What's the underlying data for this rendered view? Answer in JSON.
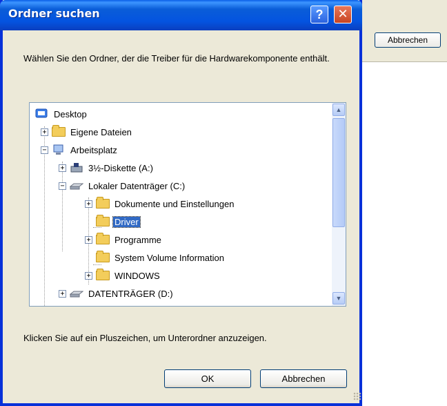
{
  "background": {
    "cancel_label": "Abbrechen"
  },
  "dialog": {
    "title": "Ordner suchen",
    "help_glyph": "?",
    "close_glyph": "✕",
    "instructions": "Wählen Sie den Ordner, der die Treiber für die Hardwarekomponente enthält.",
    "hint": "Klicken Sie auf ein Pluszeichen, um Unterordner anzuzeigen.",
    "ok_label": "OK",
    "cancel_label": "Abbrechen"
  },
  "tree": {
    "items": [
      {
        "label": "Desktop",
        "icon": "desktop-icon",
        "expander": "none",
        "selected": false
      },
      {
        "label": "Eigene Dateien",
        "icon": "documents-folder-icon",
        "expander": "+",
        "selected": false
      },
      {
        "label": "Arbeitsplatz",
        "icon": "computer-icon",
        "expander": "−",
        "selected": false
      },
      {
        "label": "3½-Diskette (A:)",
        "icon": "floppy-drive-icon",
        "expander": "+",
        "selected": false
      },
      {
        "label": "Lokaler Datenträger (C:)",
        "icon": "hard-drive-icon",
        "expander": "−",
        "selected": false
      },
      {
        "label": "Dokumente und Einstellungen",
        "icon": "folder-icon",
        "expander": "+",
        "selected": false
      },
      {
        "label": "Driver",
        "icon": "folder-icon",
        "expander": "none",
        "selected": true
      },
      {
        "label": "Programme",
        "icon": "folder-icon",
        "expander": "+",
        "selected": false
      },
      {
        "label": "System Volume Information",
        "icon": "folder-icon",
        "expander": "none",
        "selected": false
      },
      {
        "label": "WINDOWS",
        "icon": "folder-icon",
        "expander": "+",
        "selected": false
      },
      {
        "label": "DATENTRÄGER (D:)",
        "icon": "hard-drive-icon",
        "expander": "+",
        "selected": false
      }
    ]
  },
  "colors": {
    "title_bar": "#0a5dd8",
    "selection": "#316ac5",
    "dialog_bg": "#ece9d8",
    "close_button": "#c84522"
  }
}
